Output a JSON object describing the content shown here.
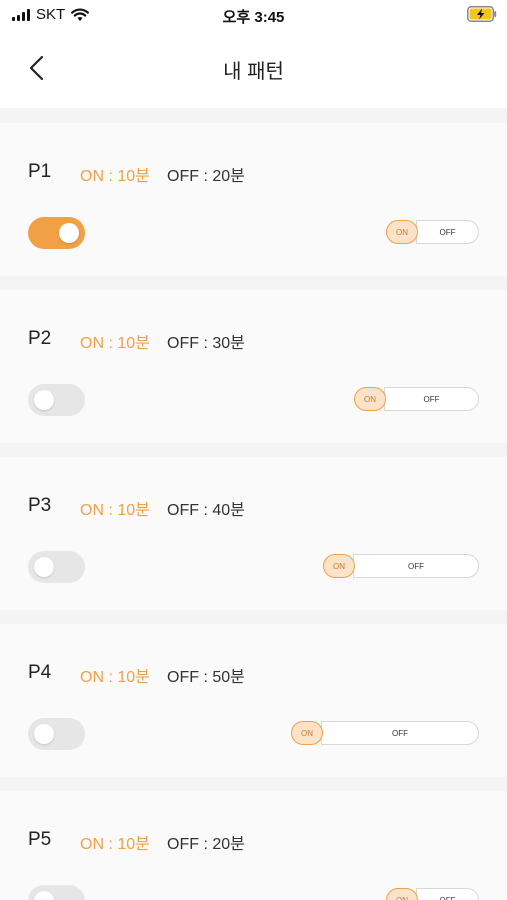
{
  "status_bar": {
    "carrier": "SKT",
    "time": "오후 3:45"
  },
  "header": {
    "title": "내 패턴"
  },
  "colors": {
    "accent": "#f2a046",
    "on_fill": "#fbe3c9",
    "toggle_off": "#e6e6e6"
  },
  "patterns": [
    {
      "label": "P1",
      "on_text": "ON : 10분",
      "off_text": "OFF : 20분",
      "enabled": true,
      "on_minutes": 10,
      "off_minutes": 20,
      "bar_on": "ON",
      "bar_off": "OFF"
    },
    {
      "label": "P2",
      "on_text": "ON : 10분",
      "off_text": "OFF : 30분",
      "enabled": false,
      "on_minutes": 10,
      "off_minutes": 30,
      "bar_on": "ON",
      "bar_off": "OFF"
    },
    {
      "label": "P3",
      "on_text": "ON : 10분",
      "off_text": "OFF : 40분",
      "enabled": false,
      "on_minutes": 10,
      "off_minutes": 40,
      "bar_on": "ON",
      "bar_off": "OFF"
    },
    {
      "label": "P4",
      "on_text": "ON : 10분",
      "off_text": "OFF : 50분",
      "enabled": false,
      "on_minutes": 10,
      "off_minutes": 50,
      "bar_on": "ON",
      "bar_off": "OFF"
    },
    {
      "label": "P5",
      "on_text": "ON : 10분",
      "off_text": "OFF : 20분",
      "enabled": false,
      "on_minutes": 10,
      "off_minutes": 20,
      "bar_on": "ON",
      "bar_off": "OFF"
    }
  ]
}
